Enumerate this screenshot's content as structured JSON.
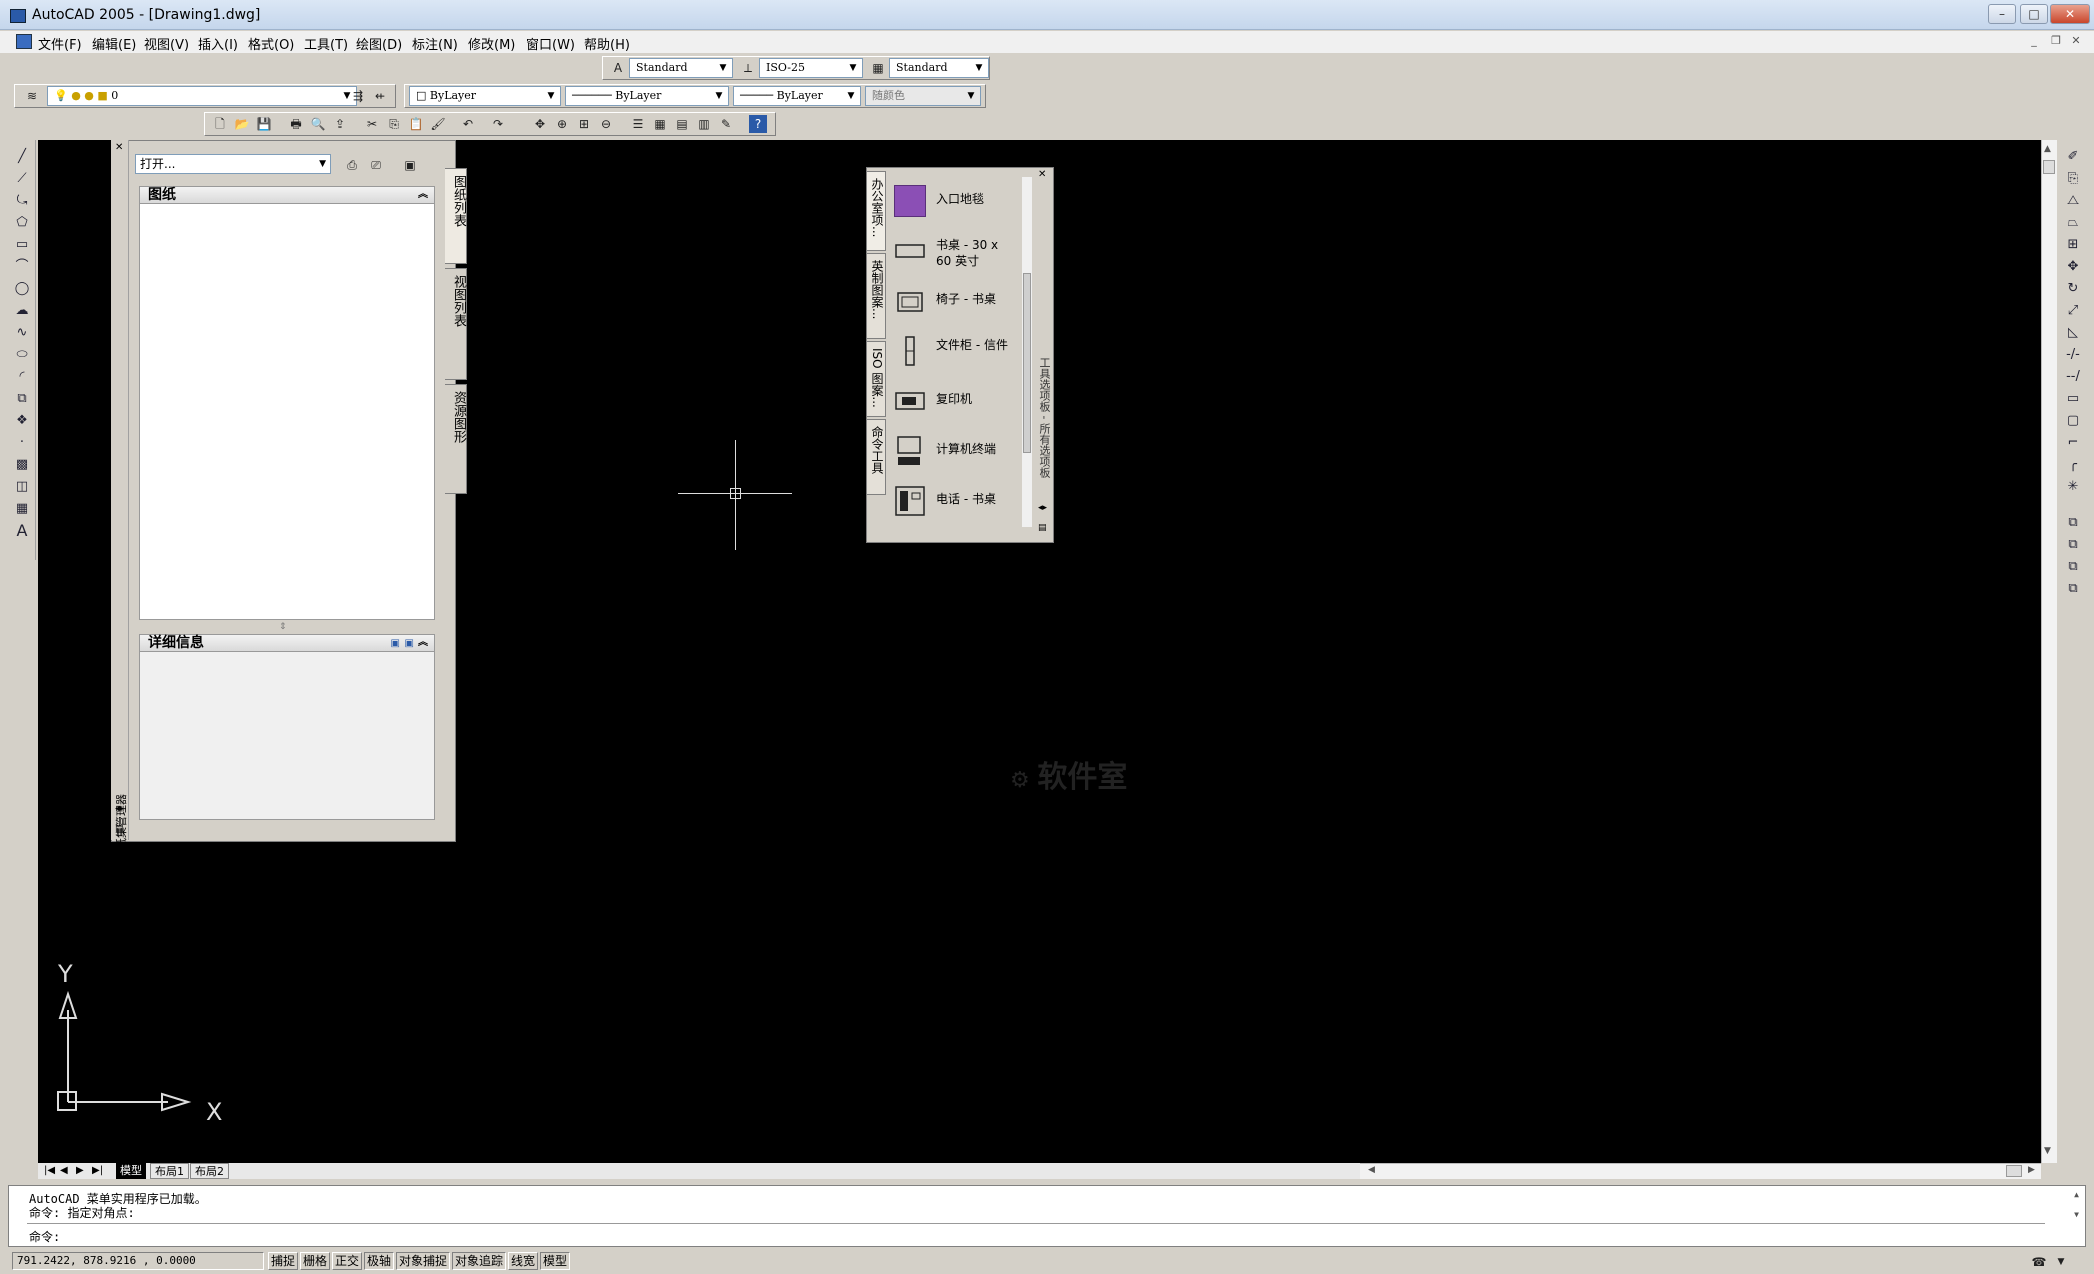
{
  "window": {
    "title": "AutoCAD 2005 - [Drawing1.dwg]"
  },
  "menu": [
    "文件(F)",
    "编辑(E)",
    "视图(V)",
    "插入(I)",
    "格式(O)",
    "工具(T)",
    "绘图(D)",
    "标注(N)",
    "修改(M)",
    "窗口(W)",
    "帮助(H)"
  ],
  "styles": {
    "text_style": "Standard",
    "dim_style": "ISO-25",
    "table_style": "Standard"
  },
  "layers": {
    "current_layer": "0",
    "color": "ByLayer",
    "linetype": "ByLayer",
    "lineweight": "ByLayer",
    "plot_style": "随颜色"
  },
  "sheet_set_manager": {
    "open_combo": "打开...",
    "sheets_header": "图纸",
    "details_header": "详细信息",
    "tabs": [
      "图纸列表",
      "视图列表",
      "资源图形"
    ],
    "title_strip": "图纸集管理器"
  },
  "tool_palette": {
    "tabs": [
      "办公室项...",
      "英制图案...",
      "ISO 图案...",
      "命令工具"
    ],
    "items": [
      {
        "label": "入口地毯",
        "icon": "rug-swatch-icon"
      },
      {
        "label": "书桌 - 30 x 60 英寸",
        "icon": "desk-icon"
      },
      {
        "label": "椅子 - 书桌",
        "icon": "chair-icon"
      },
      {
        "label": "文件柜 - 信件",
        "icon": "file-cabinet-icon"
      },
      {
        "label": "复印机",
        "icon": "copier-icon"
      },
      {
        "label": "计算机终端",
        "icon": "computer-terminal-icon"
      },
      {
        "label": "电话 - 书桌",
        "icon": "desk-phone-icon"
      }
    ],
    "side_label": "工具选项板 - 所有选项板",
    "rug_color": "#8b4fb5"
  },
  "ucs": {
    "y_label": "Y",
    "x_label": "X"
  },
  "watermark": "软件室",
  "layout_tabs": [
    "模型",
    "布局1",
    "布局2"
  ],
  "command": {
    "history": [
      "AutoCAD 菜单实用程序已加载。",
      "命令: 指定对角点:"
    ],
    "prompt": "命令:"
  },
  "status": {
    "coords": "791.2422,  878.9216 , 0.0000",
    "buttons": [
      "捕捉",
      "栅格",
      "正交",
      "极轴",
      "对象捕捉",
      "对象追踪",
      "线宽",
      "模型"
    ]
  }
}
